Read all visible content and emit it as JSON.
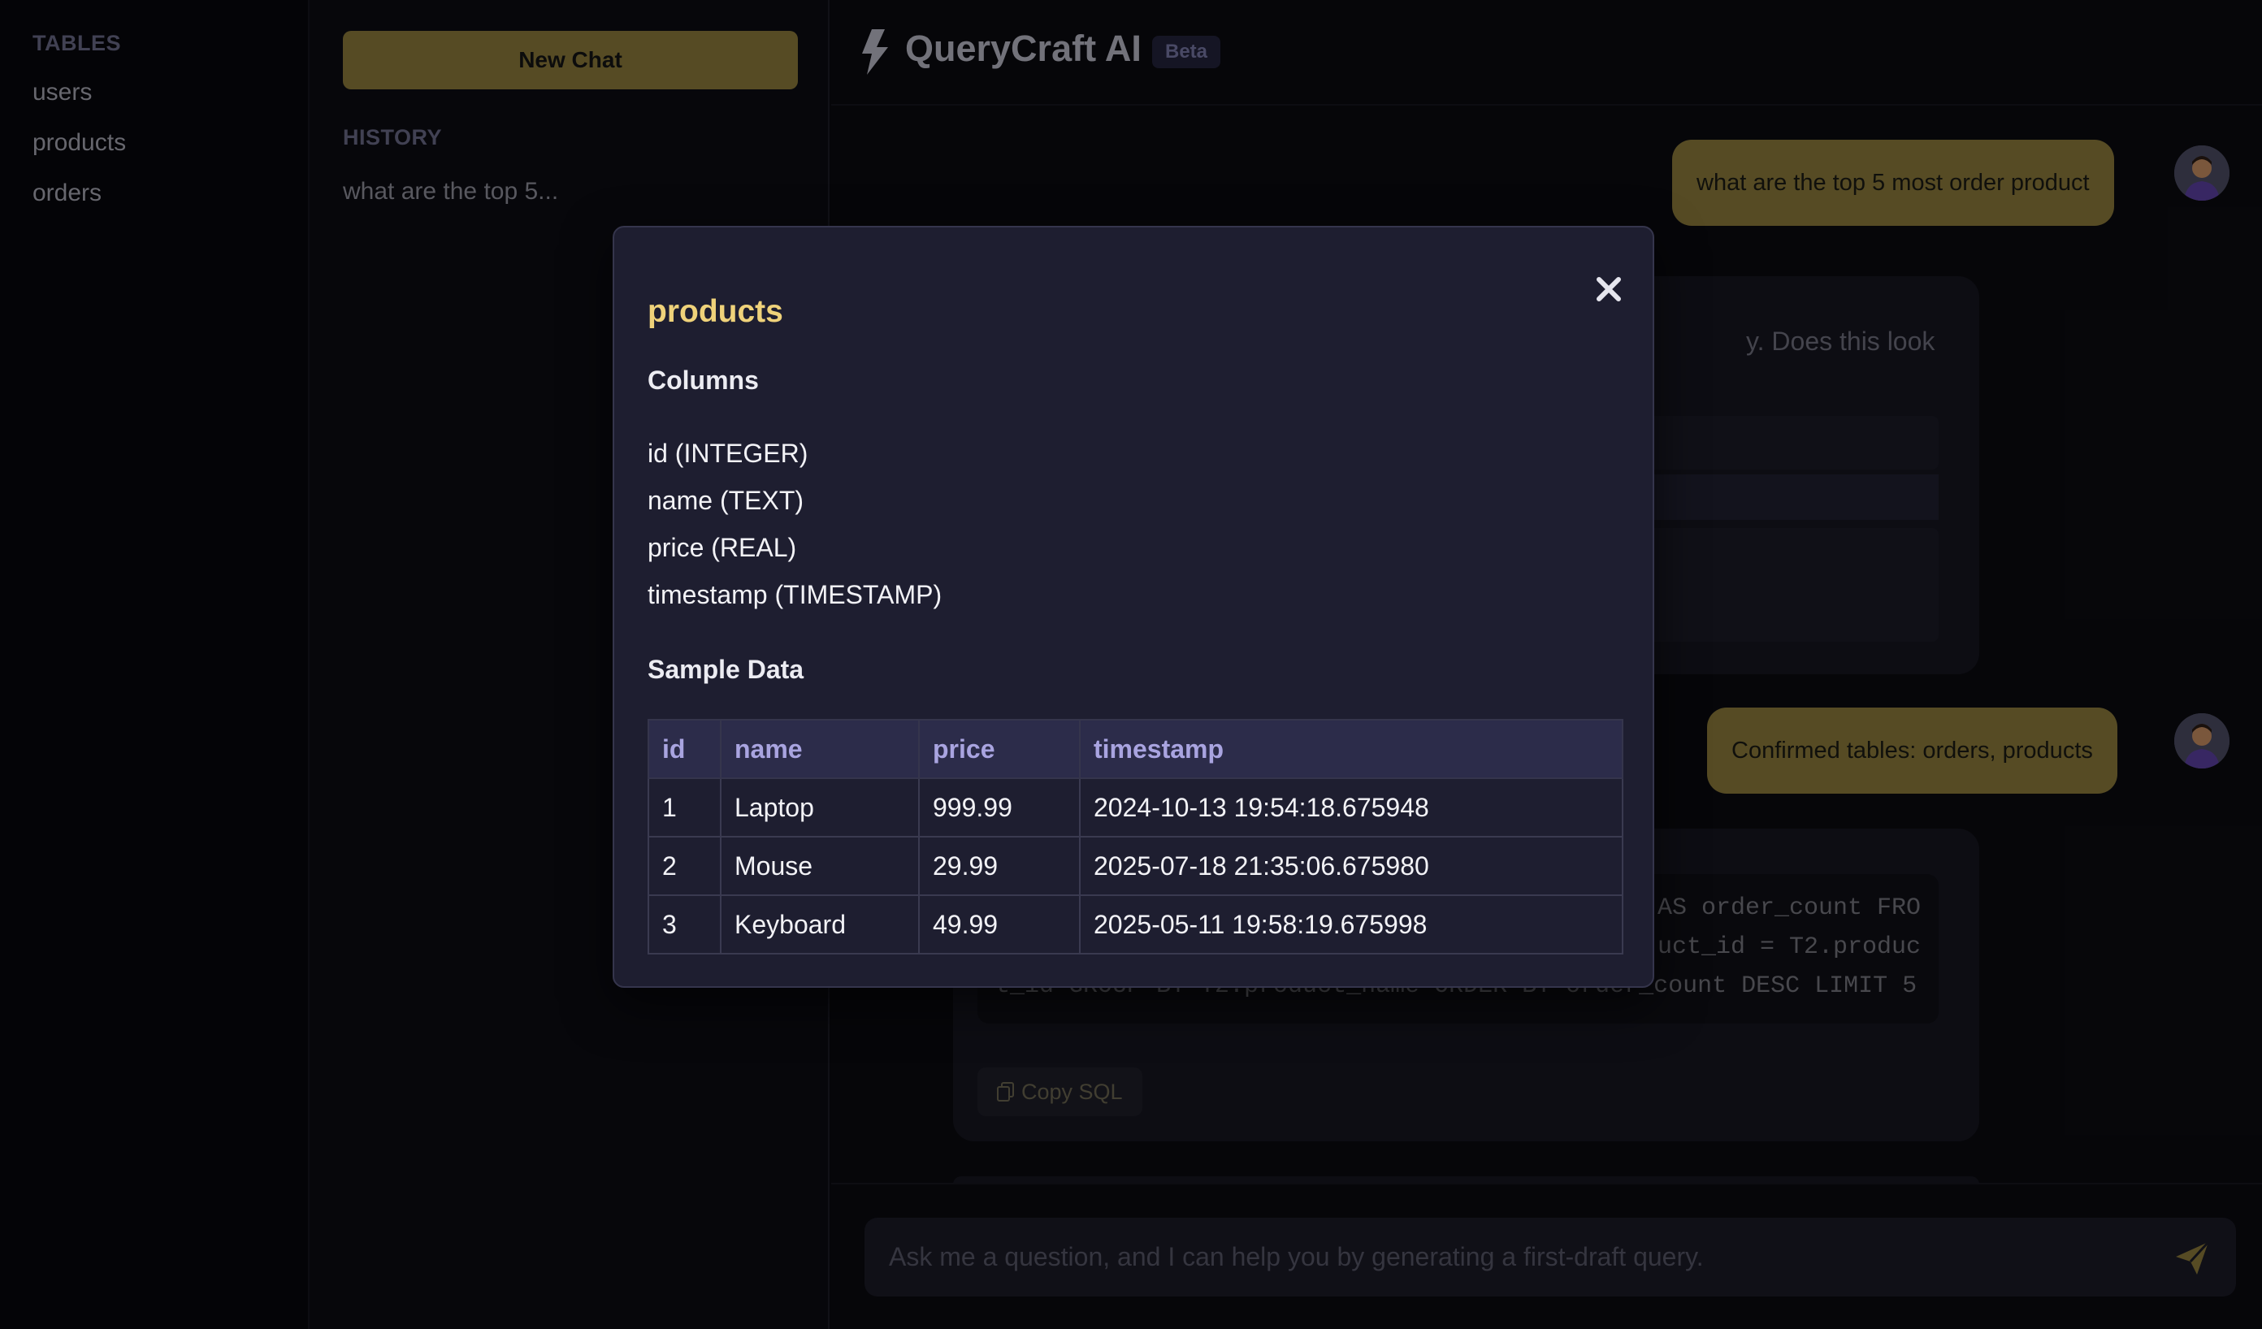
{
  "sidebar": {
    "heading": "TABLES",
    "items": [
      {
        "label": "users"
      },
      {
        "label": "products"
      },
      {
        "label": "orders"
      }
    ]
  },
  "history": {
    "new_chat_label": "New Chat",
    "heading": "HISTORY",
    "items": [
      {
        "label": "what are the top 5..."
      }
    ]
  },
  "header": {
    "title": "QueryCraft AI",
    "badge": "Beta",
    "icon": "lightning-bolt-icon"
  },
  "chat": {
    "messages": [
      {
        "role": "user",
        "text": "what are the top 5 most order product"
      },
      {
        "role": "assistant",
        "text_visible": "y. Does this look"
      },
      {
        "role": "user",
        "text": "Confirmed tables: orders, products"
      },
      {
        "role": "assistant",
        "sql_lines": [
          "AS order_count FRO",
          "uct_id = T2.produc",
          "t_id GROUP BY T2.product_name ORDER BY order_count DESC LIMIT 5"
        ],
        "copy_label": "Copy SQL"
      }
    ]
  },
  "input": {
    "placeholder": "Ask me a question, and I can help you by generating a first-draft query.",
    "value": ""
  },
  "modal": {
    "title": "products",
    "columns_heading": "Columns",
    "columns": [
      {
        "label": "id (INTEGER)"
      },
      {
        "label": "name (TEXT)"
      },
      {
        "label": "price (REAL)"
      },
      {
        "label": "timestamp (TIMESTAMP)"
      }
    ],
    "sample_heading": "Sample Data",
    "table": {
      "headers": [
        "id",
        "name",
        "price",
        "timestamp"
      ],
      "rows": [
        [
          "1",
          "Laptop",
          "999.99",
          "2024-10-13 19:54:18.675948"
        ],
        [
          "2",
          "Mouse",
          "29.99",
          "2025-07-18 21:35:06.675980"
        ],
        [
          "3",
          "Keyboard",
          "49.99",
          "2025-05-11 19:58:19.675998"
        ]
      ]
    }
  },
  "colors": {
    "accent_gold": "#8b7a3a",
    "modal_title": "#efd27a",
    "table_header_text": "#a9a4e0",
    "background": "#0b0b10"
  }
}
